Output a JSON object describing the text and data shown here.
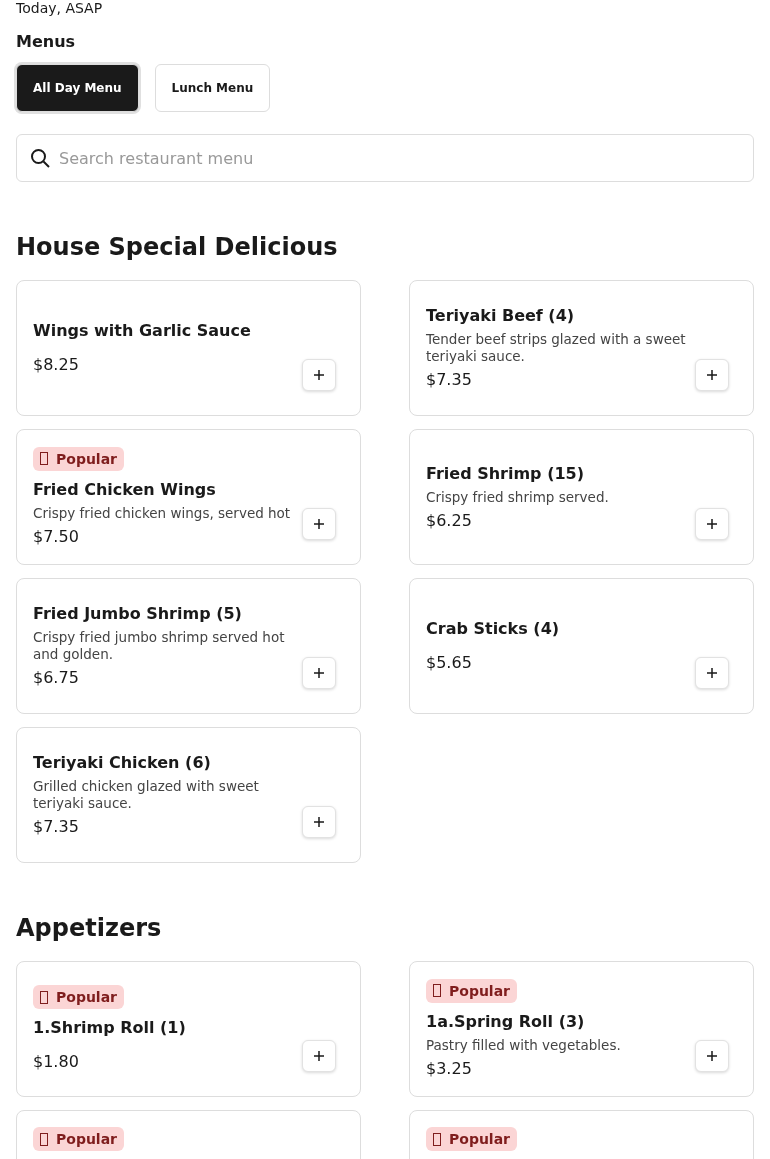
{
  "delivery_time": "Today, ASAP",
  "menus": {
    "title": "Menus",
    "tabs": [
      {
        "label": "All Day Menu",
        "selected": true
      },
      {
        "label": "Lunch Menu",
        "selected": false
      }
    ]
  },
  "search": {
    "placeholder": "Search restaurant menu"
  },
  "sections": [
    {
      "title": "House Special Delicious",
      "items": [
        {
          "name": "Wings with Garlic Sauce",
          "price": "$8.25",
          "popular": false
        },
        {
          "name": "Teriyaki Beef (4)",
          "description": "Tender beef strips glazed with a sweet teriyaki sauce.",
          "price": "$7.35",
          "popular": false
        },
        {
          "name": "Fried Chicken Wings",
          "description": "Crispy fried chicken wings, served hot",
          "price": "$7.50",
          "popular": true,
          "badge": "Popular"
        },
        {
          "name": "Fried Shrimp (15)",
          "description": "Crispy fried shrimp served.",
          "price": "$6.25",
          "popular": false
        },
        {
          "name": "Fried Jumbo Shrimp (5)",
          "description": "Crispy fried jumbo shrimp served hot and golden.",
          "price": "$6.75",
          "popular": false
        },
        {
          "name": "Crab Sticks (4)",
          "price": "$5.65",
          "popular": false
        },
        {
          "name": "Teriyaki Chicken (6)",
          "description": "Grilled chicken glazed with sweet teriyaki sauce.",
          "price": "$7.35",
          "popular": false
        }
      ]
    },
    {
      "title": "Appetizers",
      "items": [
        {
          "name": "1.Shrimp Roll (1)",
          "price": "$1.80",
          "popular": true,
          "badge": "Popular"
        },
        {
          "name": "1a.Spring Roll (3)",
          "description": "Pastry filled with vegetables.",
          "price": "$3.25",
          "popular": true,
          "badge": "Popular"
        },
        {
          "popular": true,
          "badge": "Popular"
        },
        {
          "popular": true,
          "badge": "Popular"
        }
      ]
    }
  ]
}
